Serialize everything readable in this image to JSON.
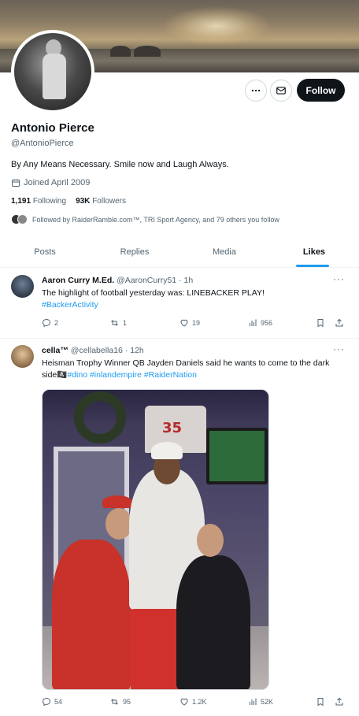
{
  "profile": {
    "name": "Antonio Pierce",
    "handle": "@AntonioPierce",
    "bio": "By Any Means Necessary. Smile now and Laugh Always.",
    "joined": "Joined April 2009",
    "following_count": "1,191",
    "following_label": "Following",
    "followers_count": "93K",
    "followers_label": "Followers",
    "followed_by": "Followed by RaiderRamble.com™, TRI Sport Agency, and 79 others you follow",
    "follow_button": "Follow"
  },
  "icons": {
    "more": "more-horizontal-icon",
    "message": "mail-icon",
    "calendar": "calendar-icon",
    "reply": "reply-icon",
    "repost": "repost-icon",
    "like": "heart-icon",
    "views": "bar-chart-icon",
    "bookmark": "bookmark-icon",
    "share": "share-icon"
  },
  "tabs": [
    {
      "label": "Posts"
    },
    {
      "label": "Replies"
    },
    {
      "label": "Media"
    },
    {
      "label": "Likes"
    }
  ],
  "active_tab": "Likes",
  "tweets": [
    {
      "name": "Aaron Curry M.Ed.",
      "handle": "@AaronCurry51",
      "time": "· 1h",
      "text": "The highlight of football yesterday was: LINEBACKER PLAY!",
      "tag_line": "#BackerActivity",
      "replies": "2",
      "reposts": "1",
      "likes": "19",
      "views": "956"
    },
    {
      "name": "cella™",
      "handle": "@cellabella16",
      "time": "· 12h",
      "text": "Heisman Trophy Winner QB Jayden Daniels said he wants to come to the dark side",
      "emoji": "🏴‍☠️",
      "tags": "#dino #inlandempire #RaiderNation",
      "replies": "54",
      "reposts": "95",
      "likes": "1.2K",
      "views": "52K"
    }
  ],
  "colors": {
    "accent": "#1d9bf0",
    "text_primary": "#0f1419",
    "text_secondary": "#536471",
    "border": "#eff3f4"
  }
}
